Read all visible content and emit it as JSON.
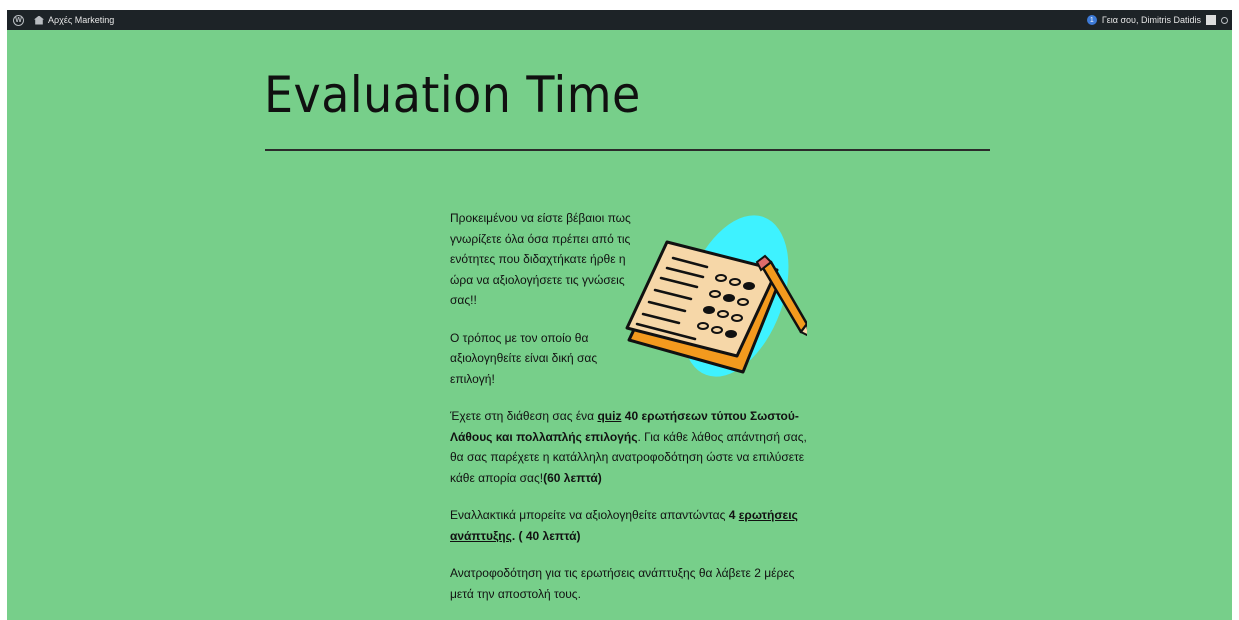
{
  "adminbar": {
    "site_name": "Αρχές Marketing",
    "notification_count": "1",
    "greeting": "Γεια σου, Dimitris Datidis"
  },
  "page": {
    "title": "Evaluation Time"
  },
  "content": {
    "intro1": "Προκειμένου να είστε βέβαιοι πως γνωρίζετε όλα όσα πρέπει από τις ενότητες που διδαχτήκατε ήρθε η ώρα να αξιολογήσετε τις γνώσεις σας!!",
    "intro2": "Ο τρόπος με τον οποίο θα αξιολογηθείτε είναι δική σας επιλογή!",
    "quiz_pre": "Έχετε στη διάθεση σας ένα ",
    "quiz_link": "quiz",
    "quiz_bold": " 40 ερωτήσεων τύπου Σωστού-Λάθους και πολλαπλής επιλογής",
    "quiz_post": ". Για κάθε λάθος απάντησή σας, θα σας παρέχετε η κατάλληλη ανατροφοδότηση ώστε να επιλύσετε κάθε απορία σας!",
    "quiz_time": "(60 λεπτά)",
    "alt_pre": "Εναλλακτικά μπορείτε να αξιολογηθείτε απαντώντας ",
    "alt_bold": "4 ",
    "alt_link": "ερωτήσεις ανάπτυξης",
    "alt_time": ". ( 40 λεπτά)",
    "feedback": "Ανατροφοδότηση για τις ερωτήσεις ανάπτυξης θα λάβετε 2 μέρες μετά την αποστολή τους."
  },
  "colors": {
    "page_bg": "#77cf8a",
    "adminbar_bg": "#1d2327",
    "blob": "#3ef2ff",
    "paper": "#f6d7a8",
    "folder": "#f39a1e"
  }
}
